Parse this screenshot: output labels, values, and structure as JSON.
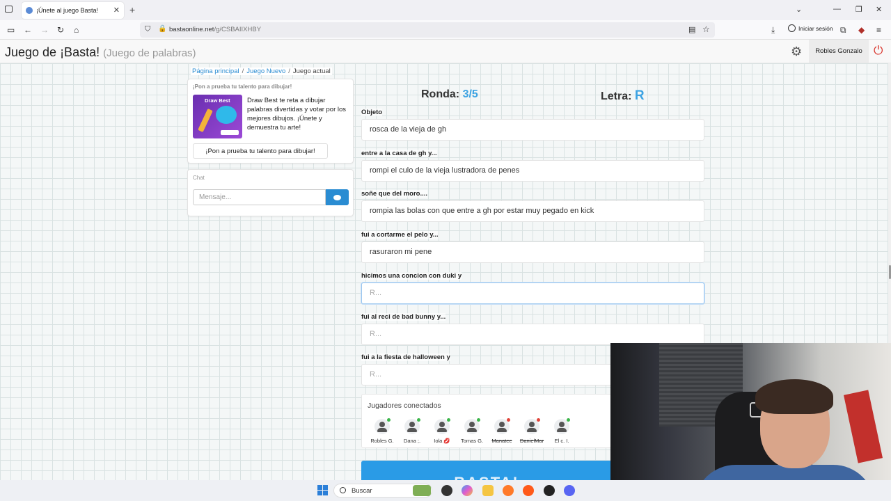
{
  "browser": {
    "tab_title": "¡Únete al juego Basta!",
    "url_host": "bastaonline.net",
    "url_path": "/g/CSBAIIXHBY",
    "signin_label": "Iniciar sesión"
  },
  "site": {
    "brand": "Juego de ¡Basta!",
    "brand_sub": "(Juego de palabras)",
    "user_name": "Robles Gonzalo"
  },
  "breadcrumb": {
    "home": "Página principal",
    "new_game": "Juego Nuevo",
    "current": "Juego actual"
  },
  "promo": {
    "heading": "¡Pon a prueba tu talento para dibujar!",
    "image_title": "Draw Best",
    "text": "Draw Best te reta a dibujar palabras divertidas y votar por los mejores dibujos. ¡Únete y demuestra tu arte!",
    "button": "¡Pon a prueba tu talento para dibujar!"
  },
  "chat": {
    "heading": "Chat",
    "placeholder": "Mensaje..."
  },
  "game": {
    "round_label": "Ronda:",
    "round_value": "3/5",
    "letter_label": "Letra:",
    "letter_value": "R"
  },
  "fields": [
    {
      "label": "Objeto",
      "value": "rosca de la vieja de gh",
      "placeholder": ""
    },
    {
      "label": "entre a la casa de gh y...",
      "value": "rompi el culo de la vieja lustradora de penes",
      "placeholder": ""
    },
    {
      "label": "soñe que del moro....",
      "value": "rompia las bolas con que entre a gh por estar muy pegado en kick",
      "placeholder": ""
    },
    {
      "label": "fui a cortarme el pelo y...",
      "value": "rasuraron mi pene",
      "placeholder": ""
    },
    {
      "label": "hicimos una concion con duki y",
      "value": "",
      "placeholder": "R..."
    },
    {
      "label": "fui al reci de bad bunny y...",
      "value": "",
      "placeholder": "R..."
    },
    {
      "label": "fui a la fiesta de halloween y",
      "value": "",
      "placeholder": "R..."
    }
  ],
  "players": {
    "title": "Jugadores conectados",
    "list": [
      {
        "name": "Robles G.",
        "status": "online",
        "dot_color": "#3cb54a"
      },
      {
        "name": "Dana ;.",
        "status": "online",
        "dot_color": "#3cb54a"
      },
      {
        "name": "Iola 💋",
        "status": "online",
        "dot_color": "#3cb54a"
      },
      {
        "name": "Tomas G.",
        "status": "online",
        "dot_color": "#3cb54a"
      },
      {
        "name": "Manatee",
        "status": "offline",
        "dot_color": "#e0443a"
      },
      {
        "name": "DanielMar",
        "status": "offline",
        "dot_color": "#e0443a"
      },
      {
        "name": "El c. I.",
        "status": "online",
        "dot_color": "#3cb54a"
      }
    ]
  },
  "basta_button": "BASTA!",
  "taskbar": {
    "search_label": "Buscar"
  },
  "colors": {
    "accent": "#2a8cd2",
    "letter": "#3da3e3",
    "power": "#d9342b"
  }
}
